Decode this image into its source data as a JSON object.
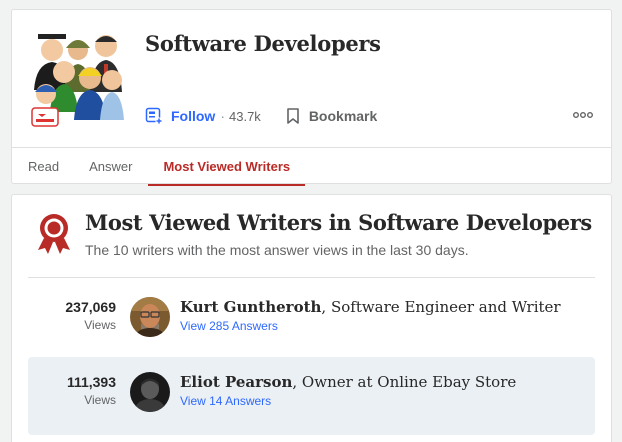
{
  "topic": {
    "title": "Software Developers",
    "avatar_icon": "software-developers-topic-illustration"
  },
  "actions": {
    "follow_label": "Follow",
    "separator": "·",
    "follow_count": "43.7k",
    "bookmark_label": "Bookmark",
    "more_icon": "ellipsis-icon"
  },
  "tabs": [
    {
      "label": "Read"
    },
    {
      "label": "Answer"
    },
    {
      "label": "Most Viewed Writers",
      "active": true
    }
  ],
  "mvw": {
    "title": "Most Viewed Writers in Software Developers",
    "subtitle": "The 10 writers with the most answer views in the last 30 days.",
    "writers": [
      {
        "views": "237,069",
        "views_label": "Views",
        "name": "Kurt Guntheroth",
        "credential": ", Software Engineer and Writer",
        "answers_link": "View 285 Answers"
      },
      {
        "views": "111,393",
        "views_label": "Views",
        "name": "Eliot Pearson",
        "credential": ", Owner at Online Ebay Store",
        "answers_link": "View 14 Answers"
      }
    ]
  },
  "colors": {
    "accent_red": "#b92b27",
    "link_blue": "#2e69ff",
    "row_highlight": "#ebf0f4"
  }
}
